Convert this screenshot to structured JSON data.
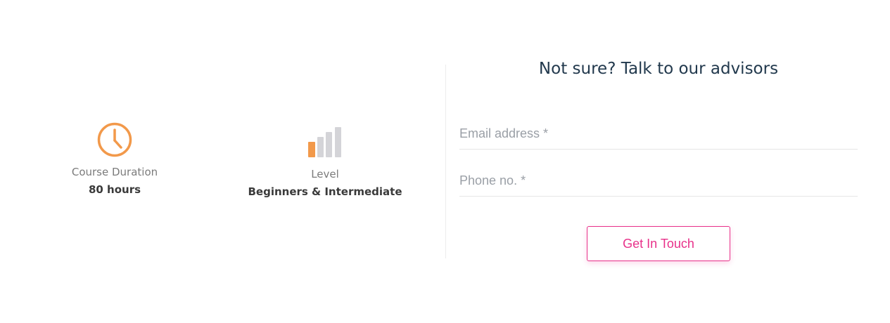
{
  "stats": {
    "duration": {
      "icon": "clock-icon",
      "label": "Course Duration",
      "value": "80 hours"
    },
    "level": {
      "icon": "signal-bars-icon",
      "label": "Level",
      "value": "Beginners & Intermediate",
      "bars_total": 4,
      "bars_active": 1
    }
  },
  "form": {
    "heading": "Not sure? Talk to our advisors",
    "email_placeholder": "Email address *",
    "phone_placeholder": "Phone no. *",
    "submit_label": "Get In Touch"
  },
  "colors": {
    "accent_orange": "#f2994a",
    "inactive_grey": "#d4d4d8",
    "cta_pink": "#e8318a",
    "heading_navy": "#22394d",
    "divider": "#ececec"
  }
}
